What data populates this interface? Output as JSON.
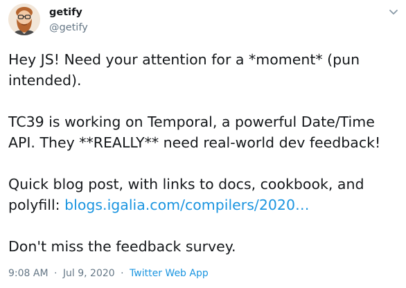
{
  "user": {
    "display_name": "getify",
    "handle": "@getify",
    "avatar_icon": "bearded-man-avatar"
  },
  "tweet": {
    "line1": "Hey JS! Need your attention for a *moment* (pun",
    "line2": "intended).",
    "line3": "TC39 is working on Temporal, a powerful Date/Time",
    "line4": "API. They **REALLY** need real-world dev feedback!",
    "line5": "Quick blog post, with links to docs, cookbook, and",
    "line6_prefix": "polyfill: ",
    "link_text": "blogs.igalia.com/compilers/2020…",
    "line7": "Don't miss the feedback survey."
  },
  "meta": {
    "time": "9:08 AM",
    "separator": "·",
    "date": "Jul 9, 2020",
    "source": "Twitter Web App"
  },
  "icons": {
    "caret": "chevron-down-icon"
  },
  "colors": {
    "link": "#1b95e0",
    "secondary_text": "#657786",
    "primary_text": "#14171a"
  }
}
